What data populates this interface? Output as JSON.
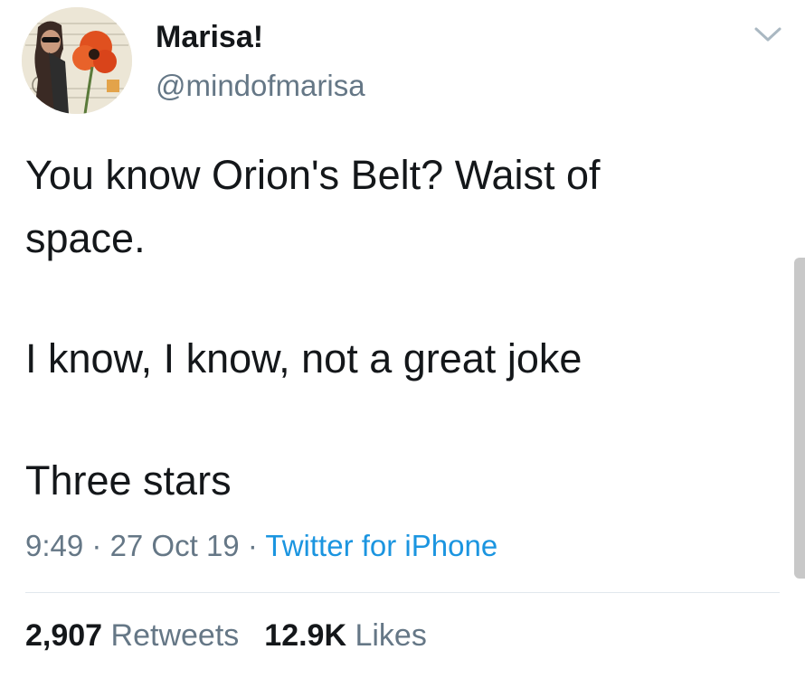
{
  "user": {
    "display_name": "Marisa!",
    "handle": "@mindofmarisa"
  },
  "tweet": {
    "line1": "You know Orion's Belt? Waist of",
    "line2": "space.",
    "line3": "I know, I know, not a great joke",
    "line4": "Three stars"
  },
  "meta": {
    "time": "9:49",
    "sep1": " · ",
    "date": "27 Oct 19",
    "sep2": " · ",
    "source": "Twitter for iPhone"
  },
  "stats": {
    "retweets_count": "2,907",
    "retweets_label": "Retweets",
    "likes_count": "12.9K",
    "likes_label": "Likes"
  },
  "icons": {
    "menu": "chevron-down-icon"
  },
  "colors": {
    "text": "#14171a",
    "secondary": "#657786",
    "link": "#1b95e0",
    "divider": "#e1e8ed"
  }
}
